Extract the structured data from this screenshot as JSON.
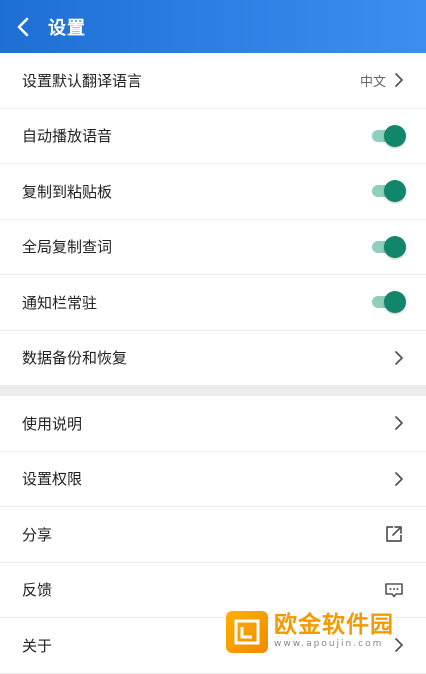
{
  "header": {
    "title": "设置",
    "back_icon": "back-arrow-icon"
  },
  "settings": [
    {
      "label": "设置默认翻译语言",
      "value": "中文",
      "control": "chevron"
    },
    {
      "label": "自动播放语音",
      "control": "toggle",
      "on": true
    },
    {
      "label": "复制到粘贴板",
      "control": "toggle",
      "on": true
    },
    {
      "label": "全局复制查词",
      "control": "toggle",
      "on": true
    },
    {
      "label": "通知栏常驻",
      "control": "toggle",
      "on": true
    },
    {
      "label": "数据备份和恢复",
      "control": "chevron"
    }
  ],
  "more": [
    {
      "label": "使用说明",
      "control": "chevron"
    },
    {
      "label": "设置权限",
      "control": "chevron"
    },
    {
      "label": "分享",
      "control": "share-icon"
    },
    {
      "label": "反馈",
      "control": "feedback-icon"
    },
    {
      "label": "关于",
      "control": "chevron"
    }
  ],
  "watermark": {
    "name": "欧金软件园",
    "url": "www.apoujin.com"
  },
  "colors": {
    "header_start": "#1e6fd4",
    "header_end": "#3c8ef0",
    "toggle_on": "#11866a",
    "toggle_track": "#8fd0bd"
  }
}
